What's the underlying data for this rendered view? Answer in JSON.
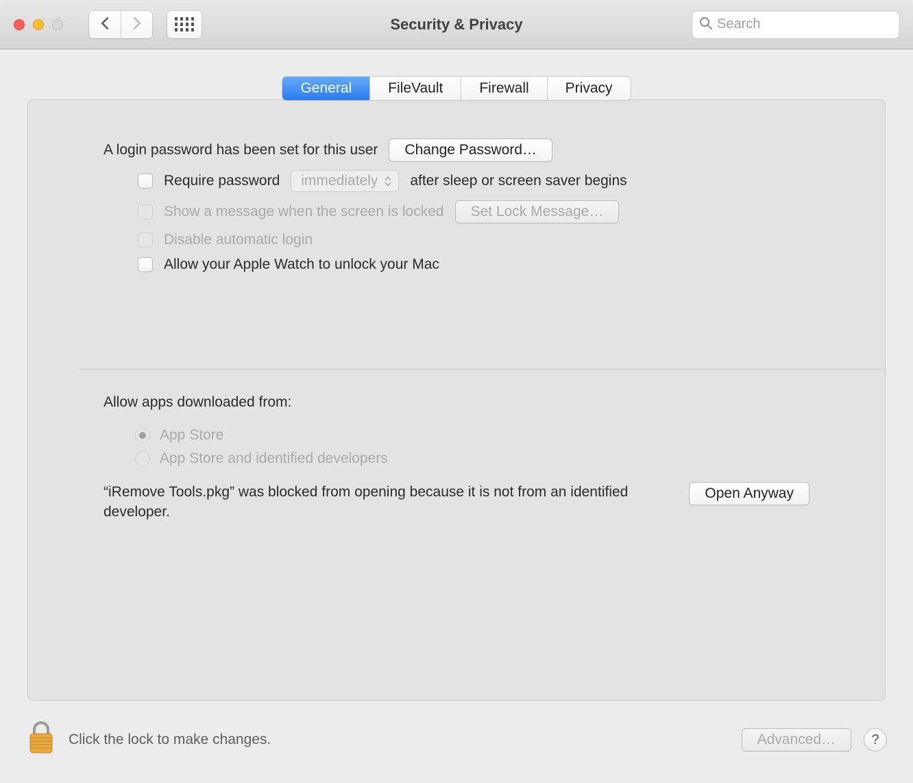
{
  "window": {
    "title": "Security & Privacy"
  },
  "toolbar": {
    "search_placeholder": "Search"
  },
  "tabs": {
    "general": "General",
    "filevault": "FileVault",
    "firewall": "Firewall",
    "privacy": "Privacy"
  },
  "general": {
    "login_password_text": "A login password has been set for this user",
    "change_password_btn": "Change Password…",
    "require_password_label": "Require password",
    "require_password_delay": "immediately",
    "require_password_after": "after sleep or screen saver begins",
    "show_message_label": "Show a message when the screen is locked",
    "set_lock_message_btn": "Set Lock Message…",
    "disable_auto_login_label": "Disable automatic login",
    "apple_watch_label": "Allow your Apple Watch to unlock your Mac",
    "allow_apps_from_label": "Allow apps downloaded from:",
    "radio_app_store": "App Store",
    "radio_identified": "App Store and identified developers",
    "blocked_text": "“iRemove Tools.pkg” was blocked from opening because it is not from an identified developer.",
    "open_anyway_btn": "Open Anyway"
  },
  "footer": {
    "lock_text": "Click the lock to make changes.",
    "advanced_btn": "Advanced…",
    "help": "?"
  }
}
